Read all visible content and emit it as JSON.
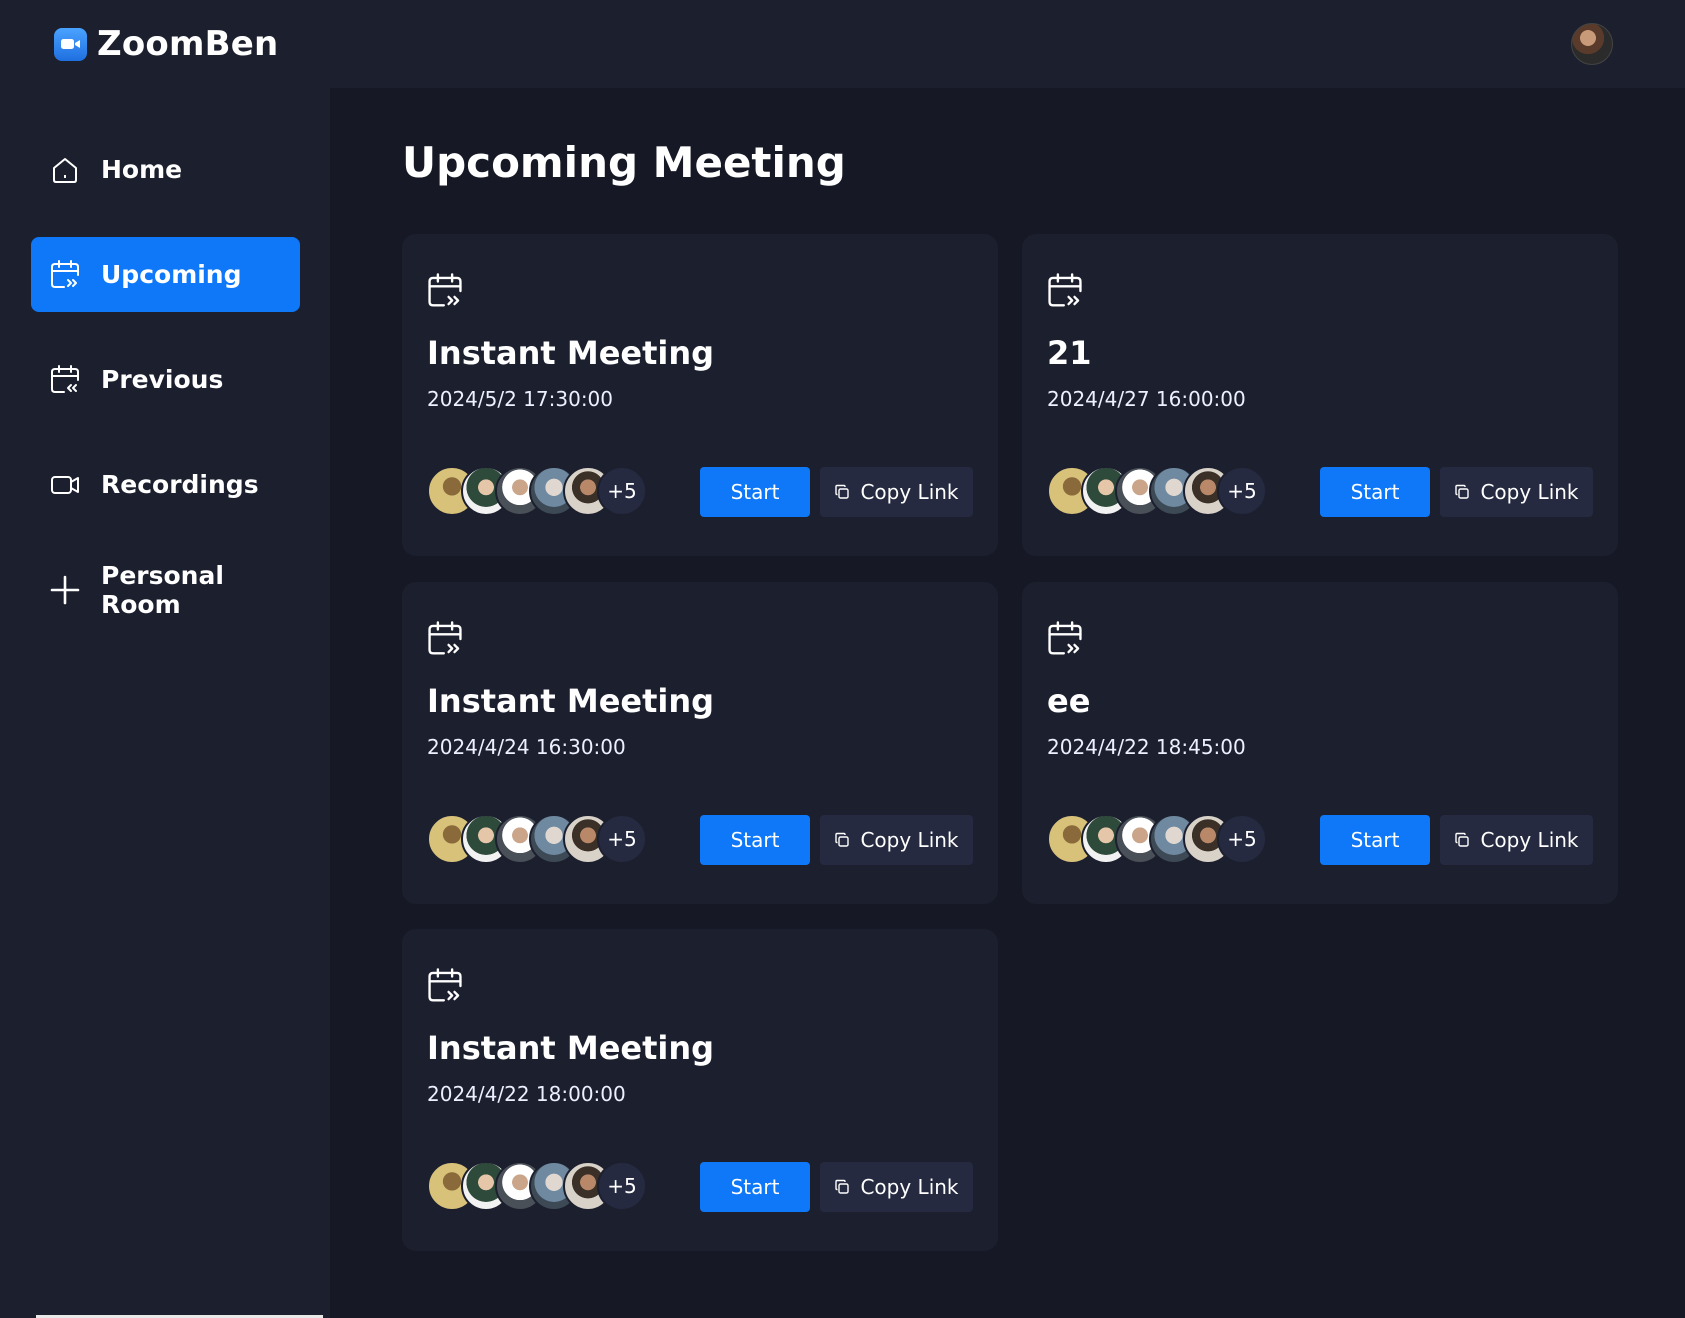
{
  "app": {
    "name": "ZoomBen"
  },
  "colors": {
    "accent": "#0e78f9",
    "surface": "#1c1f2e",
    "background": "#161925",
    "secondary_button": "#252a41"
  },
  "sidebar": {
    "items": [
      {
        "label": "Home",
        "icon": "home-icon",
        "active": false
      },
      {
        "label": "Upcoming",
        "icon": "calendar-upcoming-icon",
        "active": true
      },
      {
        "label": "Previous",
        "icon": "calendar-previous-icon",
        "active": false
      },
      {
        "label": "Recordings",
        "icon": "video-icon",
        "active": false
      },
      {
        "label": "Personal Room",
        "icon": "plus-icon",
        "active": false
      }
    ]
  },
  "main": {
    "title": "Upcoming Meeting",
    "cards": [
      {
        "title": "Instant Meeting",
        "date": "2024/5/2 17:30:00",
        "more_count": "+5",
        "start_label": "Start",
        "copy_label": "Copy Link"
      },
      {
        "title": "21",
        "date": "2024/4/27 16:00:00",
        "more_count": "+5",
        "start_label": "Start",
        "copy_label": "Copy Link"
      },
      {
        "title": "Instant Meeting",
        "date": "2024/4/24 16:30:00",
        "more_count": "+5",
        "start_label": "Start",
        "copy_label": "Copy Link"
      },
      {
        "title": "ee",
        "date": "2024/4/22 18:45:00",
        "more_count": "+5",
        "start_label": "Start",
        "copy_label": "Copy Link"
      },
      {
        "title": "Instant Meeting",
        "date": "2024/4/22 18:00:00",
        "more_count": "+5",
        "start_label": "Start",
        "copy_label": "Copy Link"
      }
    ]
  }
}
